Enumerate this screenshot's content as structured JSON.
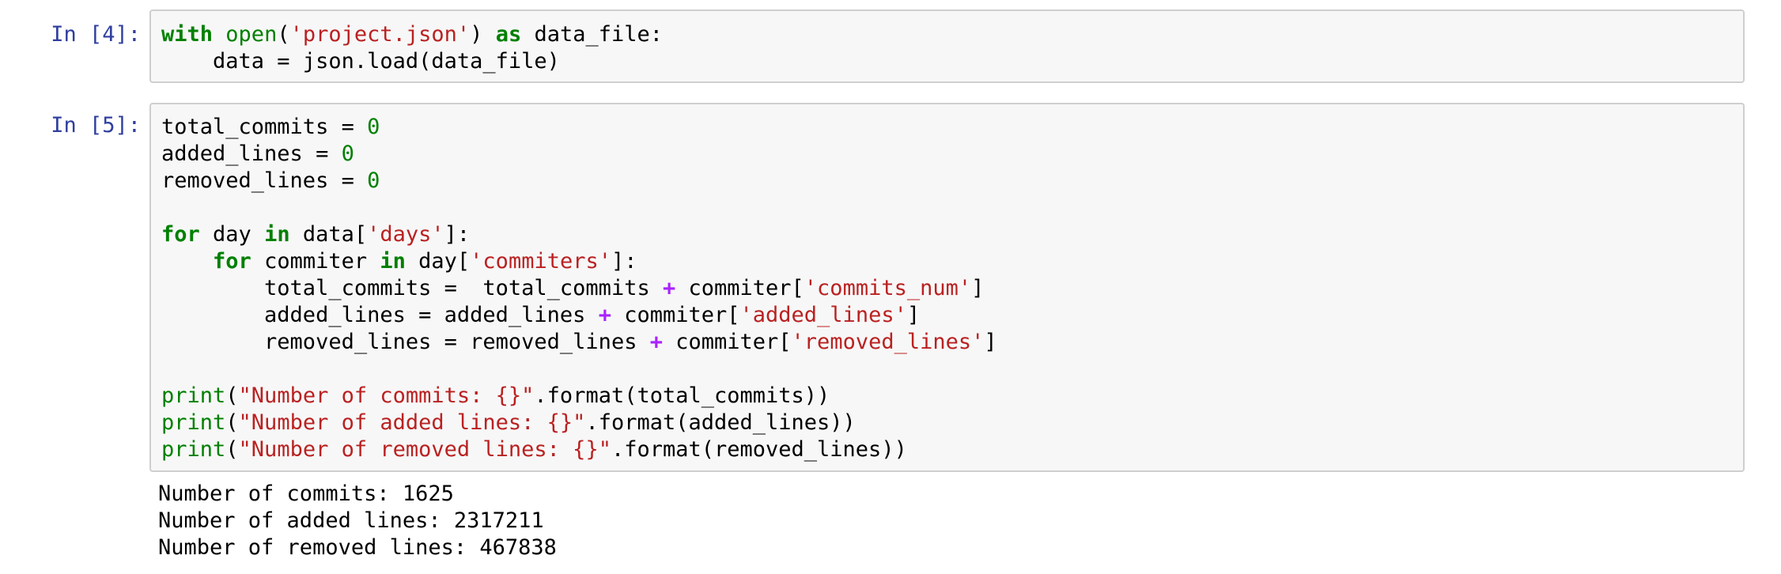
{
  "cells": [
    {
      "prompt": "In [4]:",
      "code_lines": [
        [
          {
            "t": "with",
            "c": "kw"
          },
          {
            "t": " ",
            "c": "plain"
          },
          {
            "t": "open",
            "c": "bi"
          },
          {
            "t": "(",
            "c": "plain"
          },
          {
            "t": "'project.json'",
            "c": "str"
          },
          {
            "t": ") ",
            "c": "plain"
          },
          {
            "t": "as",
            "c": "kw"
          },
          {
            "t": " data_file:",
            "c": "plain"
          }
        ],
        [
          {
            "t": "    data = json.load(data_file)",
            "c": "plain"
          }
        ]
      ]
    },
    {
      "prompt": "In [5]:",
      "code_lines": [
        [
          {
            "t": "total_commits = ",
            "c": "plain"
          },
          {
            "t": "0",
            "c": "num"
          }
        ],
        [
          {
            "t": "added_lines = ",
            "c": "plain"
          },
          {
            "t": "0",
            "c": "num"
          }
        ],
        [
          {
            "t": "removed_lines = ",
            "c": "plain"
          },
          {
            "t": "0",
            "c": "num"
          }
        ],
        [],
        [
          {
            "t": "for",
            "c": "kw"
          },
          {
            "t": " day ",
            "c": "plain"
          },
          {
            "t": "in",
            "c": "kw"
          },
          {
            "t": " data[",
            "c": "plain"
          },
          {
            "t": "'days'",
            "c": "str"
          },
          {
            "t": "]:",
            "c": "plain"
          }
        ],
        [
          {
            "t": "    ",
            "c": "plain"
          },
          {
            "t": "for",
            "c": "kw"
          },
          {
            "t": " commiter ",
            "c": "plain"
          },
          {
            "t": "in",
            "c": "kw"
          },
          {
            "t": " day[",
            "c": "plain"
          },
          {
            "t": "'commiters'",
            "c": "str"
          },
          {
            "t": "]:",
            "c": "plain"
          }
        ],
        [
          {
            "t": "        total_commits =  total_commits ",
            "c": "plain"
          },
          {
            "t": "+",
            "c": "op"
          },
          {
            "t": " commiter[",
            "c": "plain"
          },
          {
            "t": "'commits_num'",
            "c": "str"
          },
          {
            "t": "]",
            "c": "plain"
          }
        ],
        [
          {
            "t": "        added_lines = added_lines ",
            "c": "plain"
          },
          {
            "t": "+",
            "c": "op"
          },
          {
            "t": " commiter[",
            "c": "plain"
          },
          {
            "t": "'added_lines'",
            "c": "str"
          },
          {
            "t": "]",
            "c": "plain"
          }
        ],
        [
          {
            "t": "        removed_lines = removed_lines ",
            "c": "plain"
          },
          {
            "t": "+",
            "c": "op"
          },
          {
            "t": " commiter[",
            "c": "plain"
          },
          {
            "t": "'removed_lines'",
            "c": "str"
          },
          {
            "t": "]",
            "c": "plain"
          }
        ],
        [],
        [
          {
            "t": "print",
            "c": "bi"
          },
          {
            "t": "(",
            "c": "plain"
          },
          {
            "t": "\"Number of commits: {}\"",
            "c": "str"
          },
          {
            "t": ".format(total_commits))",
            "c": "plain"
          }
        ],
        [
          {
            "t": "print",
            "c": "bi"
          },
          {
            "t": "(",
            "c": "plain"
          },
          {
            "t": "\"Number of added lines: {}\"",
            "c": "str"
          },
          {
            "t": ".format(added_lines))",
            "c": "plain"
          }
        ],
        [
          {
            "t": "print",
            "c": "bi"
          },
          {
            "t": "(",
            "c": "plain"
          },
          {
            "t": "\"Number of removed lines: {}\"",
            "c": "str"
          },
          {
            "t": ".format(removed_lines))",
            "c": "plain"
          }
        ]
      ],
      "output_lines": [
        "Number of commits: 1625",
        "Number of added lines: 2317211",
        "Number of removed lines: 467838"
      ]
    }
  ]
}
